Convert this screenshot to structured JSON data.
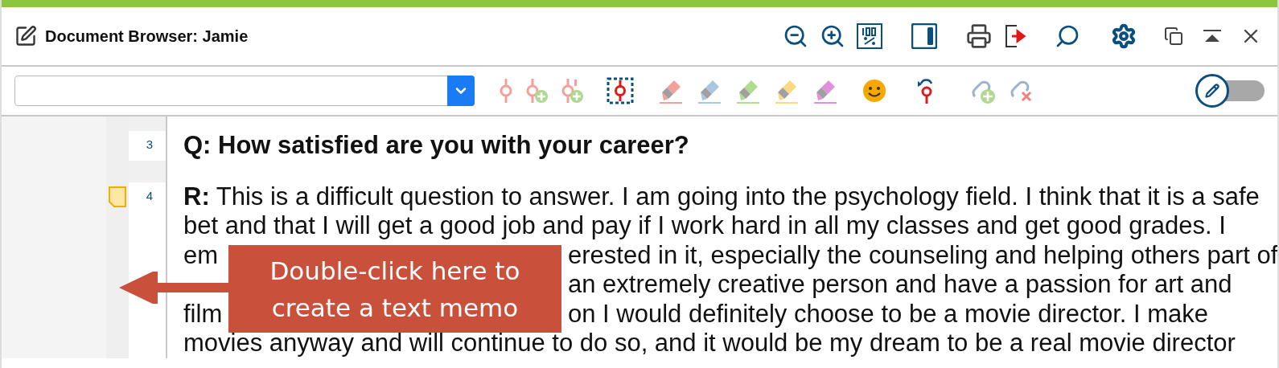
{
  "window": {
    "title": "Document Browser: Jamie"
  },
  "highlighters": [
    {
      "color": "#f4a09a"
    },
    {
      "color": "#a8c8e0"
    },
    {
      "color": "#b0dc90"
    },
    {
      "color": "#fcd880"
    },
    {
      "color": "#e090dc"
    }
  ],
  "edit_toggle": {
    "on": false
  },
  "paragraphs": [
    {
      "number": "3",
      "kind": "question",
      "memo": false,
      "lines": [
        {
          "kind": "full",
          "text": "Q: How satisfied are you with your career?"
        }
      ]
    },
    {
      "number": "4",
      "kind": "answer",
      "memo": true,
      "lines": [
        {
          "kind": "full",
          "text": "**R:** This is a difficult question to answer. I am going into the psychology field. I think that it is a safe"
        },
        {
          "kind": "full",
          "text": "bet and that I will get a good job and pay if I work hard in all my classes and get good grades. I"
        },
        {
          "kind": "covered",
          "left": "em",
          "right": "erested in it, especially the counseling and helping others part of"
        },
        {
          "kind": "covered",
          "right": "an extremely creative person and have a passion for art and"
        },
        {
          "kind": "covered",
          "left": "film",
          "right": "on I would definitely choose to be a movie director. I make"
        },
        {
          "kind": "full",
          "text": "movies anyway and will continue to do so, and it would be my dream to be a real movie director"
        }
      ]
    }
  ],
  "callout": {
    "text": "Double-click here to\ncreate a text memo"
  }
}
